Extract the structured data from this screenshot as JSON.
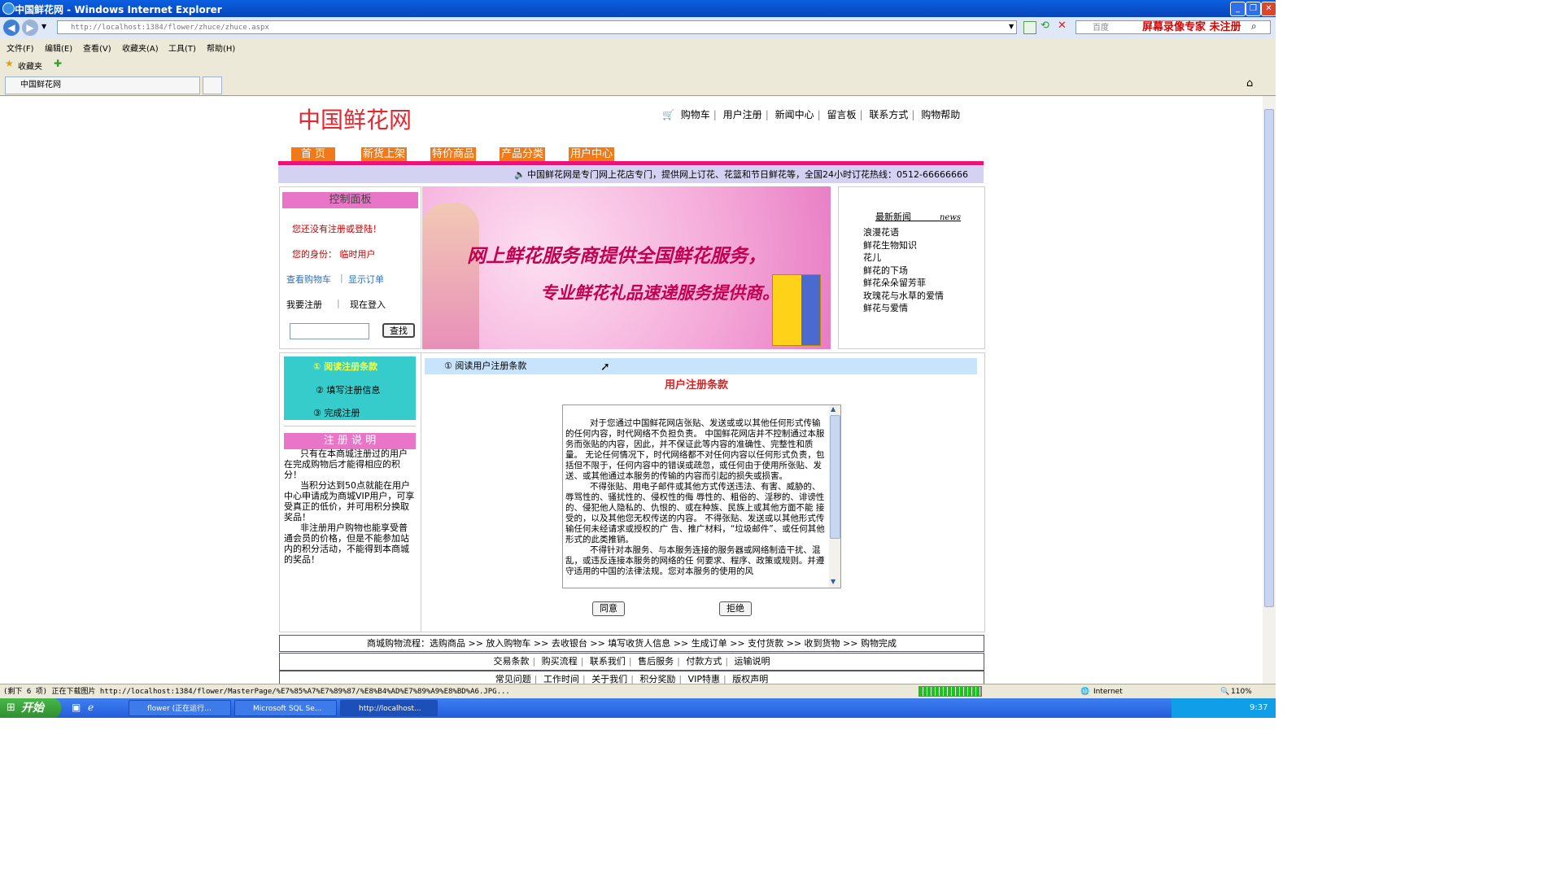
{
  "window": {
    "title": "中国鲜花网 - Windows Internet Explorer"
  },
  "browser": {
    "url": "http://localhost:1384/flower/zhuce/zhuce.aspx",
    "search_placeholder": "百度",
    "watermark": "屏幕录像专家 未注册",
    "menu": [
      "文件(F)",
      "编辑(E)",
      "查看(V)",
      "收藏夹(A)",
      "工具(T)",
      "帮助(H)"
    ],
    "favorites_label": "收藏夹",
    "tab_title": "中国鲜花网",
    "status_text": "(剩下 6 项) 正在下载图片 http://localhost:1384/flower/MasterPage/%E7%85%A7%E7%89%87/%E8%B4%AD%E7%89%A9%E8%BD%A6.JPG...",
    "zone": "Internet",
    "zoom": "110%"
  },
  "site": {
    "logo": "中国鲜花网",
    "top_links": [
      "购物车",
      "用户注册",
      "新闻中心",
      "留言板",
      "联系方式",
      "购物帮助"
    ],
    "nav": [
      "首  页",
      "新货上架",
      "特价商品",
      "产品分类",
      "用户中心"
    ],
    "marquee": "中国鲜花网是专门网上花店专门，提供网上订花、花篮和节日鲜花等，全国24小时订花热线：0512-66666666"
  },
  "control_panel": {
    "title": "控制面板",
    "not_registered": "您还没有注册或登陆！",
    "identity_label": "您的身份：",
    "identity_value": "临时用户",
    "view_cart": "查看购物车",
    "show_orders": "显示订单",
    "register": "我要注册",
    "login": "现在登入",
    "search_value": "",
    "search_button": "查找"
  },
  "banner": {
    "line1": "网上鲜花服务商提供全国鲜花服务，",
    "line2": "专业鲜花礼品速递服务提供商。"
  },
  "news": {
    "title": "最新新闻",
    "title_en": "news",
    "items": [
      "浪漫花语",
      "鲜花生物知识",
      "花儿",
      "鲜花的下场",
      "鲜花朵朵留芳菲",
      "玫瑰花与水草的爱情",
      "鲜花与爱情"
    ]
  },
  "steps": [
    "① 阅读注册条款",
    "② 填写注册信息",
    "③ 完成注册"
  ],
  "reg_notes": {
    "title": "注 册 说 明",
    "paragraphs": [
      "只有在本商城注册过的用户在完成购物后才能得相应的积分！",
      "当积分达到50点就能在用户中心申请成为商城VIP用户，可享受真正的低价，并可用积分换取奖品！",
      "非注册用户购物也能享受普通会员的价格，但是不能参加站内的积分活动，不能得到本商城的奖品！"
    ]
  },
  "terms": {
    "step_header": "① 阅读用户注册条款",
    "title": "用户注册条款",
    "paragraphs": [
      "对于您通过中国鲜花网店张贴、发送或或以其他任何形式传输的任何内容，时代网络不负担负责。 中国鲜花网店并不控制通过本服务而张贴的内容，因此，并不保证此等内容的准确性、完整性和质量。 无论任何情况下，时代网络都不对任何内容以任何形式负责，包括但不限于，任何内容中的错误或疏忽，或任何由于使用所张贴、发送、或其他通过本服务的传输的内容而引起的损失或损害。",
      "不得张贴、用电子邮件或其他方式传送违法、有害、威胁的、辱骂性的、骚扰性的、侵权性的侮 辱性的、粗俗的、淫秽的、诽谤性的、侵犯他人隐私的、仇恨的、或在种族、民族上或其他方面不能 接受的，以及其他您无权传送的内容。 不得张贴、发送或以其他形式传输任何未经请求或授权的广 告、推广材料，“垃圾邮件”、或任何其他形式的此类推销。",
      "不得针对本服务、与本服务连接的服务器或网络制造干扰、混乱，或违反连接本服务的网络的任 何要求、程序、政策或规则。并遵守适用的中国的法律法规。您对本服务的使用的风"
    ],
    "agree": "同意",
    "reject": "拒绝"
  },
  "footer": {
    "process": "商城购物流程：选购商品 >> 放入购物车 >> 去收银台 >> 填写收货人信息 >> 生成订单 >> 支付货款 >> 收到货物 >> 购物完成",
    "links1": [
      "交易条款",
      "购买流程",
      "联系我们",
      "售后服务",
      "付款方式",
      "运输说明"
    ],
    "links2": [
      "常见问题",
      "工作时间",
      "关于我们",
      "积分奖励",
      "VIP特惠",
      "版权声明"
    ]
  },
  "taskbar": {
    "start": "开始",
    "tasks": [
      "flower (正在运行...",
      "Microsoft SQL Se...",
      "http://localhost..."
    ],
    "time": "9:37"
  },
  "colors": {
    "brand_red": "#e8262e",
    "nav_orange": "#f07a1a",
    "accent_pink": "#f0107a",
    "panel_pink": "#e975c9",
    "step_cyan": "#37cccc"
  }
}
